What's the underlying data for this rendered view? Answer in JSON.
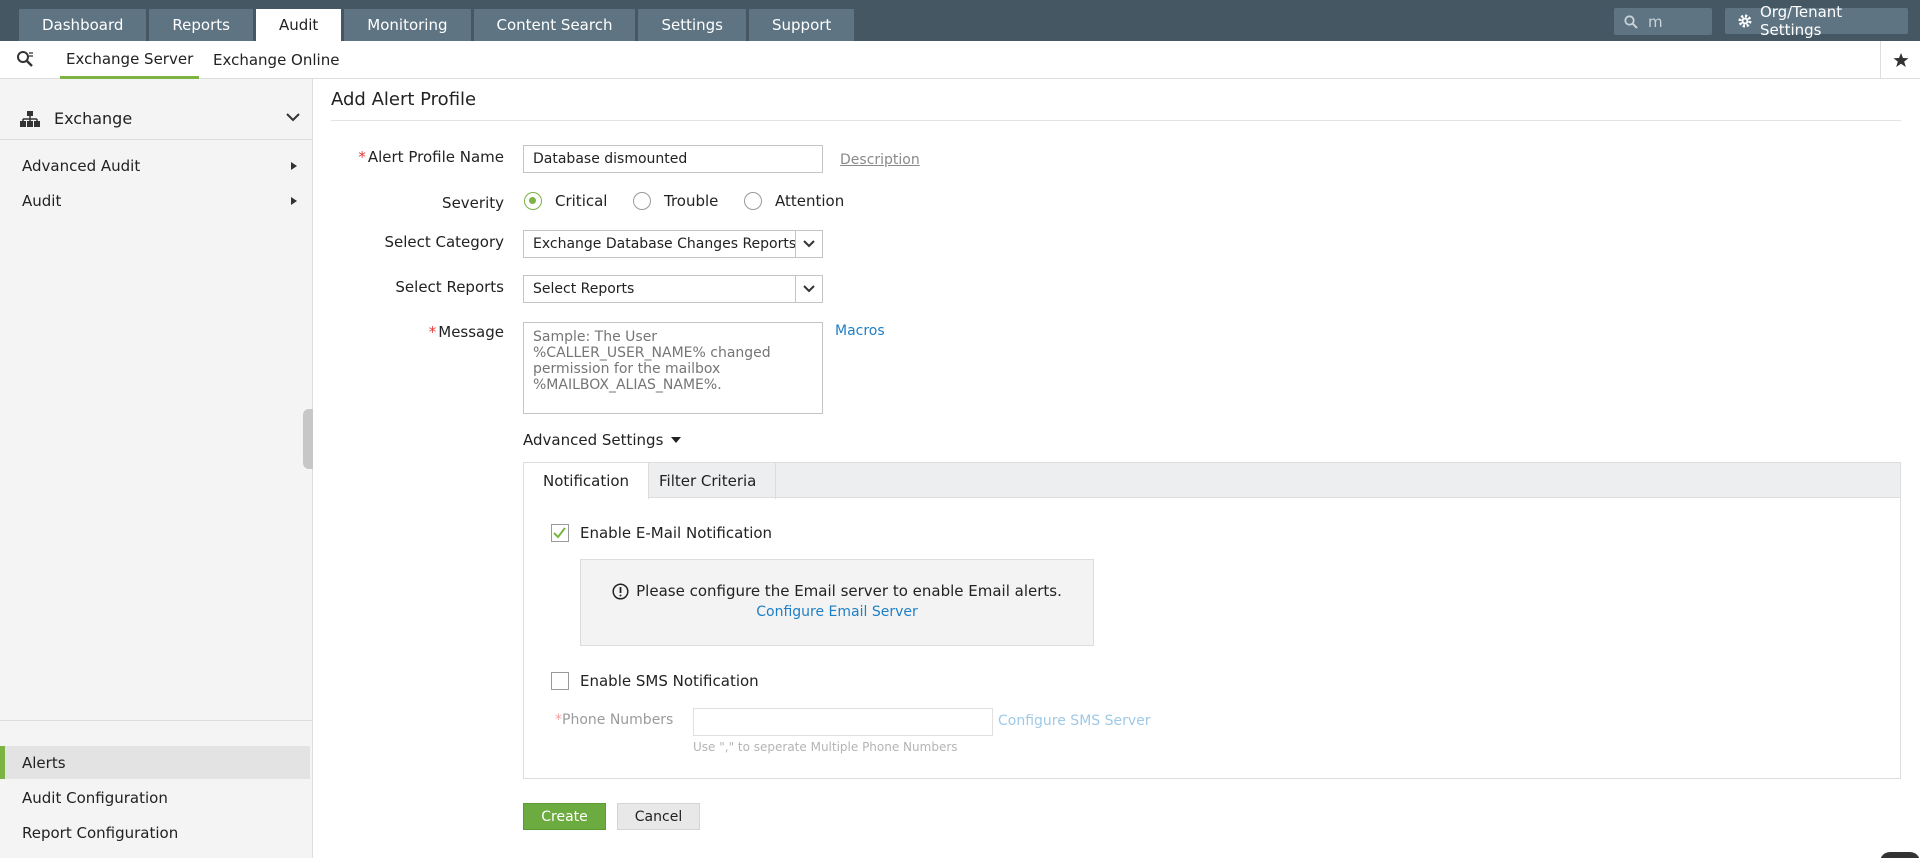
{
  "topnav": {
    "tabs": [
      {
        "label": "Dashboard"
      },
      {
        "label": "Reports"
      },
      {
        "label": "Audit",
        "active": true
      },
      {
        "label": "Monitoring"
      },
      {
        "label": "Content Search"
      },
      {
        "label": "Settings"
      },
      {
        "label": "Support"
      }
    ],
    "search_value": "m",
    "org_settings_label": "Org/Tenant Settings"
  },
  "subnav": {
    "tabs": [
      {
        "label": "Exchange Server",
        "active": true
      },
      {
        "label": "Exchange Online"
      }
    ]
  },
  "sidebar": {
    "header": "Exchange",
    "items": [
      {
        "label": "Advanced Audit"
      },
      {
        "label": "Audit"
      }
    ],
    "bottom_items": [
      {
        "label": "Alerts",
        "active": true
      },
      {
        "label": "Audit Configuration"
      },
      {
        "label": "Report Configuration"
      }
    ]
  },
  "form": {
    "title": "Add Alert Profile",
    "profile_name_label": "Alert Profile Name",
    "profile_name_value": "Database dismounted",
    "description_link": "Description",
    "severity_label": "Severity",
    "severity_options": [
      {
        "label": "Critical",
        "selected": true
      },
      {
        "label": "Trouble",
        "selected": false
      },
      {
        "label": "Attention",
        "selected": false
      }
    ],
    "category_label": "Select Category",
    "category_value": "Exchange Database Changes Reports",
    "reports_label": "Select Reports",
    "reports_value": "Select Reports",
    "message_label": "Message",
    "message_placeholder": "Sample: The User %CALLER_USER_NAME% changed permission for the mailbox %MAILBOX_ALIAS_NAME%.",
    "macros_link": "Macros",
    "advanced_settings_label": "Advanced Settings",
    "panel_tabs": [
      {
        "label": "Notification",
        "active": true
      },
      {
        "label": "Filter Criteria"
      }
    ],
    "email_notification_label": "Enable E-Mail Notification",
    "email_notification_checked": true,
    "email_info_message": "Please configure the Email server to enable Email alerts.",
    "configure_email_link": "Configure Email Server",
    "sms_notification_label": "Enable SMS Notification",
    "sms_notification_checked": false,
    "phone_numbers_label": "Phone Numbers",
    "configure_sms_link": "Configure SMS Server",
    "phone_hint": "Use \",\" to seperate Multiple Phone Numbers",
    "create_label": "Create",
    "cancel_label": "Cancel"
  },
  "colors": {
    "topbar": "#465764",
    "accent": "#7cb342",
    "link": "#1e7fc6",
    "create_button": "#6cab3f"
  }
}
